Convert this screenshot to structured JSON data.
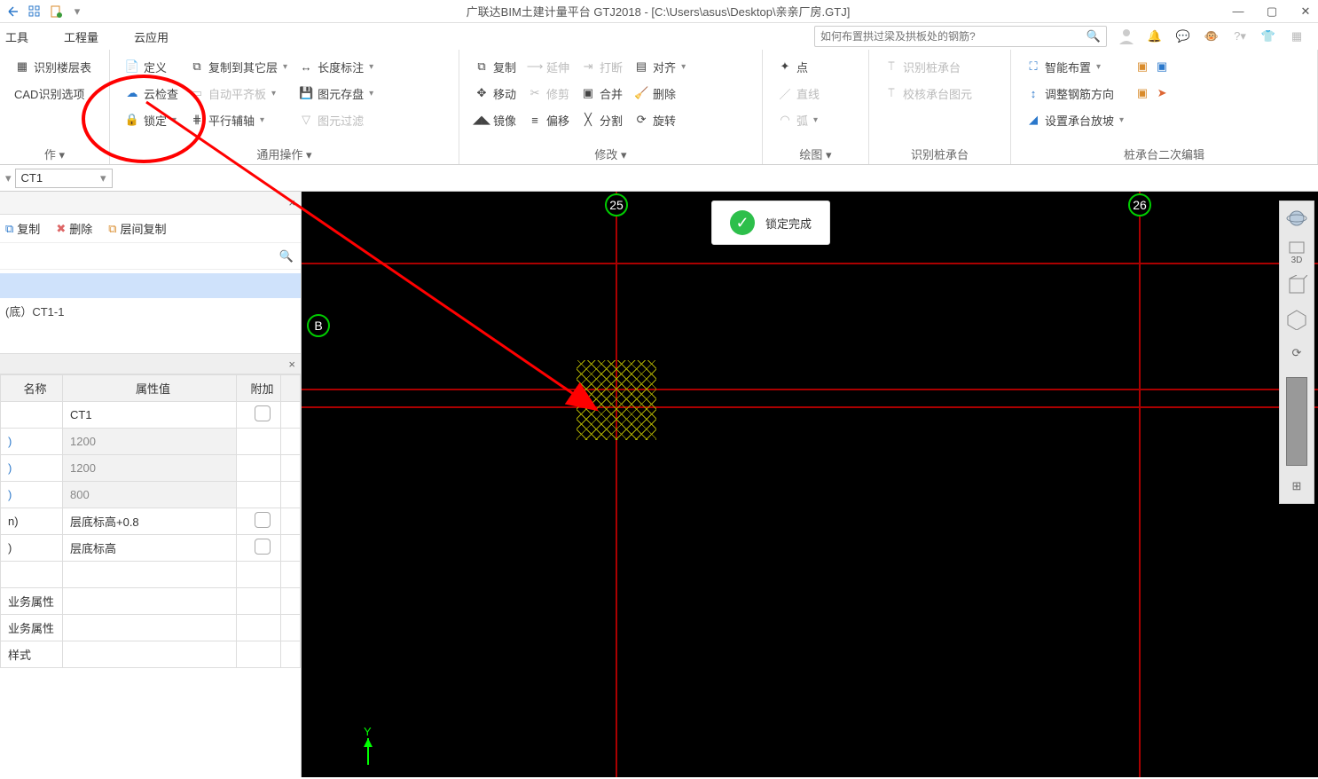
{
  "title": "广联达BIM土建计量平台 GTJ2018 - [C:\\Users\\asus\\Desktop\\亲亲厂房.GTJ]",
  "menu": {
    "tools": "工具",
    "qty": "工程量",
    "cloud": "云应用"
  },
  "search": {
    "placeholder": "如何布置拱过梁及拱板处的钢筋?"
  },
  "ribbon": {
    "g1": {
      "identifyFloor": "识别楼层表",
      "cadOptions": "CAD识别选项",
      "groupLabel": "作 ▾"
    },
    "g2": {
      "define": "定义",
      "cloudCheck": "云检查",
      "lock": "锁定",
      "copyToOther": "复制到其它层",
      "autoAlign": "自动平齐板",
      "parallelAux": "平行辅轴",
      "lengthDim": "长度标注",
      "elemSave": "图元存盘",
      "elemFilter": "图元过滤",
      "groupLabel": "通用操作 ▾"
    },
    "g3": {
      "copy": "复制",
      "move": "移动",
      "mirror": "镜像",
      "extend": "延伸",
      "trim": "修剪",
      "offset": "偏移",
      "break": "打断",
      "merge": "合并",
      "split": "分割",
      "align": "对齐",
      "delete": "删除",
      "rotate": "旋转",
      "groupLabel": "修改 ▾"
    },
    "g4": {
      "point": "点",
      "line": "直线",
      "arc": "弧",
      "groupLabel": "绘图 ▾"
    },
    "g5": {
      "identify": "识别桩承台",
      "verify": "校核承台图元",
      "groupLabel": "识别桩承台"
    },
    "g6": {
      "smartLayout": "智能布置",
      "adjustRebar": "调整钢筋方向",
      "setSlope": "设置承台放坡",
      "groupLabel": "桩承台二次编辑"
    }
  },
  "selector": {
    "item": "CT1"
  },
  "panelToolbar": {
    "copy": "复制",
    "delete": "删除",
    "floorCopy": "层间复制"
  },
  "panelList": {
    "selected": "",
    "child": "(底）CT1-1"
  },
  "props": {
    "thName": "名称",
    "thVal": "属性值",
    "thExtra": "附加",
    "r1": {
      "n": "",
      "v": "CT1"
    },
    "r2": {
      "n": ")",
      "v": "1200"
    },
    "r3": {
      "n": ")",
      "v": "1200"
    },
    "r4": {
      "n": ")",
      "v": "800"
    },
    "r5": {
      "n": "n)",
      "v": "层底标高+0.8"
    },
    "r6": {
      "n": ")",
      "v": "层底标高"
    },
    "r7": {
      "n": "",
      "v": ""
    },
    "r8": {
      "n": "业务属性",
      "v": ""
    },
    "r9": {
      "n": "业务属性",
      "v": ""
    },
    "r10": {
      "n": "样式",
      "v": ""
    }
  },
  "canvas": {
    "label25": "25",
    "label26": "26",
    "labelB": "B",
    "toast": "锁定完成",
    "vt3d": "3D"
  }
}
